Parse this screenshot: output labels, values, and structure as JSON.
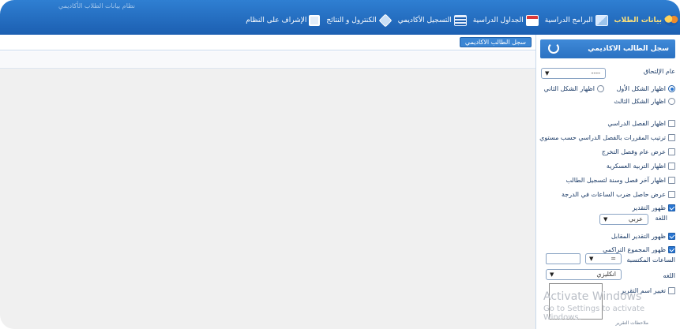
{
  "topbar": {
    "faint_title": "نظام بيانات الطلاب الأكاديمي"
  },
  "menu": [
    {
      "label": "بيانات الطلاب",
      "icon": "users-icon",
      "active": true
    },
    {
      "label": "البرامج الدراسية",
      "icon": "book-icon",
      "active": false
    },
    {
      "label": "الجداول الدراسية",
      "icon": "calendar-icon",
      "active": false
    },
    {
      "label": "التسجيل الأكاديمي",
      "icon": "list-icon",
      "active": false
    },
    {
      "label": "الكنترول و النتائج",
      "icon": "diamond-icon",
      "active": false
    },
    {
      "label": "الإشراف على النظام",
      "icon": "monitor-icon",
      "active": false
    }
  ],
  "content": {
    "tab_label": "سجل الطالب الاكاديمي"
  },
  "sidebar": {
    "title": "سجل الطالب الاكاديمي",
    "year_label": "عام الإلتحاق",
    "year_value": "----",
    "radios": [
      {
        "label": "اظهار الشكل الأول",
        "checked": true
      },
      {
        "label": "اظهار الشكل الثاني",
        "checked": false
      },
      {
        "label": "اظهار الشكل الثالث",
        "checked": false
      }
    ],
    "checks": [
      {
        "label": "اظهار الفصل الدراسي",
        "checked": false
      },
      {
        "label": "ترتيب المقررات بالفصل الدراسي حسب مستوي",
        "checked": false
      },
      {
        "label": "عرض عام وفصل التخرج",
        "checked": false
      },
      {
        "label": "اظهار التربية العسكرية",
        "checked": false
      },
      {
        "label": "اظهار آخر فصل وسنة لتسجيل الطالب",
        "checked": false
      },
      {
        "label": "عرض حاصل ضرب الساعات في الدرجة",
        "checked": false
      },
      {
        "label": "ظهور التقدير",
        "checked": true
      }
    ],
    "language_label": "اللغة",
    "language_value": "عربي",
    "check_equiv": {
      "label": "ظهور التقدير المقابل",
      "checked": true
    },
    "check_cumulative": {
      "label": "ظهور المجموع التراكمي",
      "checked": true
    },
    "earned_hours_label": "الساعات المكتسبة",
    "operator_value": "=",
    "language2_label": "اللغه",
    "language2_value": "انكليزي",
    "check_rename": {
      "label": "تغيير اسم التقرير",
      "checked": false
    },
    "cut_label": "ملاحظات التقرير"
  },
  "watermark": {
    "line1": "Activate Windows",
    "line2": "Go to Settings to activate Windows."
  },
  "colors": {
    "topbar": "#1c5fb1",
    "accent": "#2a76d2",
    "active_menu": "#ffe27a"
  }
}
